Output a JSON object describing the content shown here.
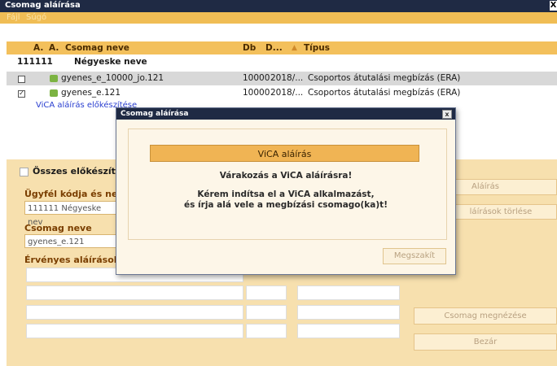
{
  "window": {
    "title": "Csomag aláírása",
    "close": "X"
  },
  "menu": [
    "Fájl",
    "Súgó"
  ],
  "table": {
    "headers": {
      "a1": "A.",
      "a2": "A.",
      "name": "Csomag neve",
      "db": "Db",
      "date": "D...",
      "type": "Típus"
    },
    "group": {
      "code": "111111",
      "name": "Négyeske neve"
    },
    "rows": [
      {
        "name": "gyenes_e_10000_jo.121",
        "db": "10000",
        "date": "2018/...",
        "type": "Csoportos átutalási megbízás (ERA)",
        "checked": false
      },
      {
        "name": "gyenes_e.121",
        "db": "10000",
        "date": "2018/...",
        "type": "Csoportos átutalási megbízás (ERA)",
        "checked": true
      }
    ],
    "link": "ViCA aláírás előkészítése"
  },
  "bottom": {
    "all_prepared": "Összes előkészített r",
    "client_label": "Ügyfél kódja és neve",
    "client_value": "111111  Négyeske nev",
    "package_label": "Csomag neve",
    "package_value": "gyenes_e.121",
    "signatures_label": "Érvényes aláírások",
    "buttons": {
      "sign": "Aláírás",
      "delete": "láírások törlése",
      "view": "Csomag megnézése",
      "close": "Bezár"
    }
  },
  "modal": {
    "title": "Csomag aláírása",
    "close": "x",
    "bar": "ViCA aláírás",
    "line1": "Várakozás a ViCA aláírásra!",
    "line2": "Kérem indítsa el a ViCA alkalmazást,",
    "line3": "és írja alá vele a megbízási csomago(ka)t!",
    "cancel": "Megszakít"
  }
}
